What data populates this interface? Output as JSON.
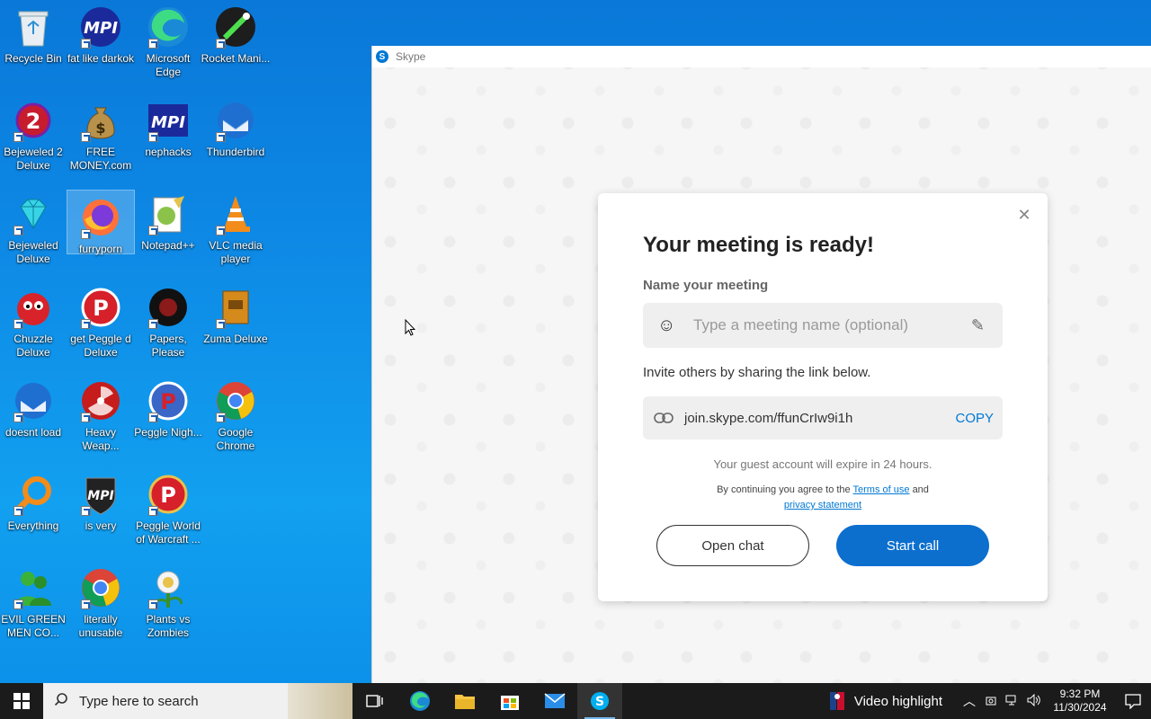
{
  "desktop": {
    "icons": [
      {
        "label": "Recycle Bin"
      },
      {
        "label": "fat like darkok"
      },
      {
        "label": "Microsoft Edge"
      },
      {
        "label": "Rocket Mani..."
      },
      {
        "label": "Bejeweled 2 Deluxe"
      },
      {
        "label": "FREE MONEY.com"
      },
      {
        "label": "nephacks"
      },
      {
        "label": "Thunderbird"
      },
      {
        "label": "Bejeweled Deluxe"
      },
      {
        "label": "furryporn"
      },
      {
        "label": "Notepad++"
      },
      {
        "label": "VLC media player"
      },
      {
        "label": "Chuzzle Deluxe"
      },
      {
        "label": "get Peggle d Deluxe"
      },
      {
        "label": "Papers, Please"
      },
      {
        "label": "Zuma Deluxe"
      },
      {
        "label": "doesnt load"
      },
      {
        "label": "Heavy Weap..."
      },
      {
        "label": "Peggle Nigh..."
      },
      {
        "label": "Google Chrome"
      },
      {
        "label": "Everything"
      },
      {
        "label": "is very"
      },
      {
        "label": "Peggle World of Warcraft ..."
      },
      {
        "label": "EVIL GREEN MEN CO..."
      },
      {
        "label": "literally unusable"
      },
      {
        "label": "Plants vs Zombies"
      }
    ]
  },
  "skype": {
    "window_title": "Skype",
    "dialog": {
      "title": "Your meeting is ready!",
      "name_label": "Name your meeting",
      "name_placeholder": "Type a meeting name (optional)",
      "invite_text": "Invite others by sharing the link below.",
      "link": "join.skype.com/ffunCrIw9i1h",
      "copy_label": "COPY",
      "expire_text": "Your guest account will expire in 24 hours.",
      "terms_prefix": "By continuing you agree to the",
      "terms_link": "Terms of use",
      "terms_and": "and",
      "privacy_link": "privacy statement",
      "open_chat_label": "Open chat",
      "start_call_label": "Start call"
    }
  },
  "taskbar": {
    "search_placeholder": "Type here to search",
    "news_text": "Video highlight",
    "time": "9:32 PM",
    "date": "11/30/2024"
  }
}
